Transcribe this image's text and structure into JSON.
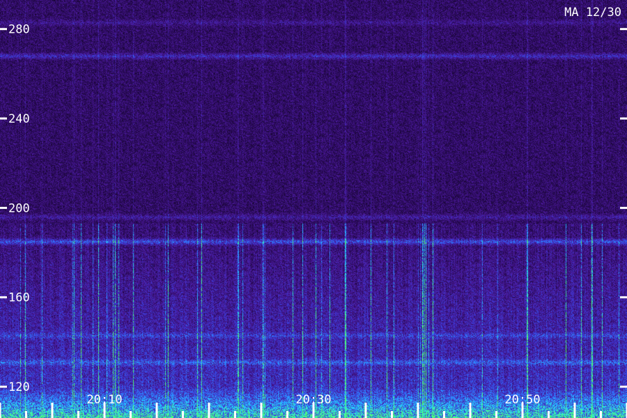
{
  "chart_data": {
    "type": "heatmap",
    "title": "MA 12/30",
    "xlabel": "",
    "ylabel": "",
    "y_ticks": [
      120,
      160,
      200,
      240,
      280
    ],
    "x_ticks": [
      "20:10",
      "20:30",
      "20:50"
    ],
    "x_tick_minutes": [
      10,
      30,
      50
    ],
    "x_range_minutes": [
      0,
      60
    ],
    "y_range": [
      106,
      293
    ],
    "colormap": [
      "#000000",
      "#2a0a5a",
      "#4b1a9c",
      "#3b3bd8",
      "#2f7fff",
      "#25d0ff",
      "#4dff7a"
    ],
    "bands": [
      {
        "y": 283,
        "intensity": 0.25
      },
      {
        "y": 268,
        "intensity": 0.55
      },
      {
        "y": 196,
        "intensity": 0.35
      },
      {
        "y": 185,
        "intensity": 0.75
      },
      {
        "y": 143,
        "intensity": 0.35
      },
      {
        "y": 131,
        "intensity": 0.45
      }
    ]
  }
}
